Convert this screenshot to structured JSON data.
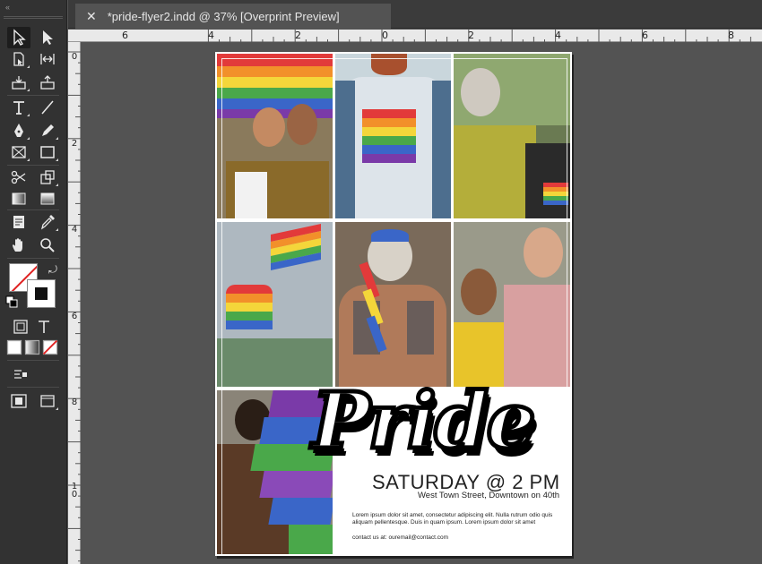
{
  "tab": {
    "close_glyph": "✕",
    "title": "*pride-flyer2.indd @ 37% [Overprint Preview]"
  },
  "ruler": {
    "top_labels": [
      "6",
      "4",
      "2",
      "0",
      "2",
      "4",
      "6",
      "8"
    ],
    "left_labels": [
      "0",
      "2",
      "4",
      "6",
      "8",
      "10"
    ]
  },
  "tools": [
    "selection-tool",
    "direct-selection-tool",
    "page-tool",
    "gap-tool",
    "content-collector-tool",
    "content-placer-tool",
    "type-tool",
    "line-tool",
    "pen-tool",
    "pencil-tool",
    "rectangle-frame-tool",
    "rectangle-tool",
    "scissors-tool",
    "free-transform-tool",
    "gradient-swatch-tool",
    "gradient-feather-tool",
    "note-tool",
    "eyedropper-tool",
    "hand-tool",
    "zoom-tool",
    "fill-stroke-swatch",
    "swap-fill-stroke",
    "default-fill-stroke",
    "formatting-container",
    "formatting-text",
    "apply-color",
    "apply-gradient",
    "apply-none",
    "place-gun",
    "normal-view-mode",
    "screen-mode"
  ],
  "flyer": {
    "headline": "Pride",
    "event": "SATURDAY @ 2 PM",
    "address": "West Town Street, Downtown on 40th",
    "body_line1": "Lorem ipsum dolor sit amet, consectetur adipiscing elit. Nulla rutrum odio quis",
    "body_line2": "aliquam pellentesque. Duis in quam ipsum. Lorem ipsum dolor sit amet",
    "contact": "contact us at: ouremail@contact.com"
  },
  "colors": {
    "app_bg": "#535353",
    "panel": "#323232",
    "ruler": "#e9e9e9",
    "page": "#ffffff"
  }
}
